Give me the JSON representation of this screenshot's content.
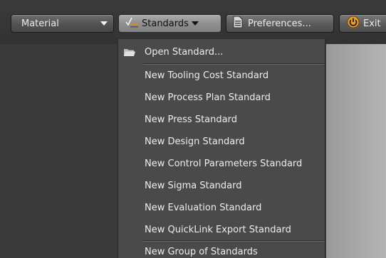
{
  "toolbar": {
    "material_label": "Material",
    "standards_label": "Standards",
    "preferences_label": "Preferences...",
    "exit_label": "Exit"
  },
  "menu": {
    "open_label": "Open Standard...",
    "items": [
      "New Tooling Cost Standard",
      "New Process Plan Standard",
      "New Press Standard",
      "New Design Standard",
      "New Control Parameters Standard",
      "New Sigma Standard",
      "New Evaluation Standard",
      "New QuickLink Export Standard"
    ],
    "group_label": "New Group of Standards"
  },
  "colors": {
    "background": "#3a3a3a",
    "menu_bg": "#4a4a4a",
    "exit_icon": "#f0a020"
  }
}
